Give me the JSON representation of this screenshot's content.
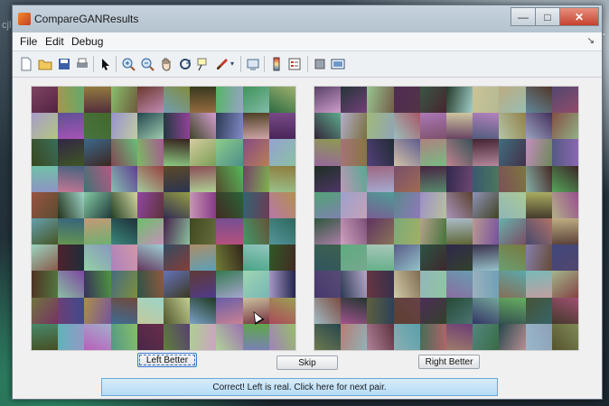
{
  "window": {
    "title": "CompareGANResults",
    "controls": {
      "minimize": "—",
      "maximize": "□",
      "close": "✕"
    }
  },
  "menu": {
    "items": [
      "File",
      "Edit",
      "Debug"
    ],
    "dock_glyph": "↘"
  },
  "toolbar": {
    "icons": [
      "new-file-icon",
      "open-folder-icon",
      "save-icon",
      "print-icon",
      "select-arrow-icon",
      "zoom-in-icon",
      "zoom-out-icon",
      "pan-hand-icon",
      "rotate-3d-icon",
      "data-cursor-icon",
      "brush-icon",
      "link-plot-icon",
      "colorbar-icon",
      "legend-icon",
      "hide-plot-tools-icon",
      "show-plot-tools-icon"
    ]
  },
  "buttons": {
    "left": "Left Better",
    "skip": "Skip",
    "right": "Right Better"
  },
  "status": {
    "message": "Correct! Left is real. Click here for next pair."
  },
  "desktop": {
    "text": "cjl"
  },
  "colors": {
    "status_bg": "#b6dcf6",
    "titlebar": "#c7d3de",
    "close": "#c6412e"
  }
}
